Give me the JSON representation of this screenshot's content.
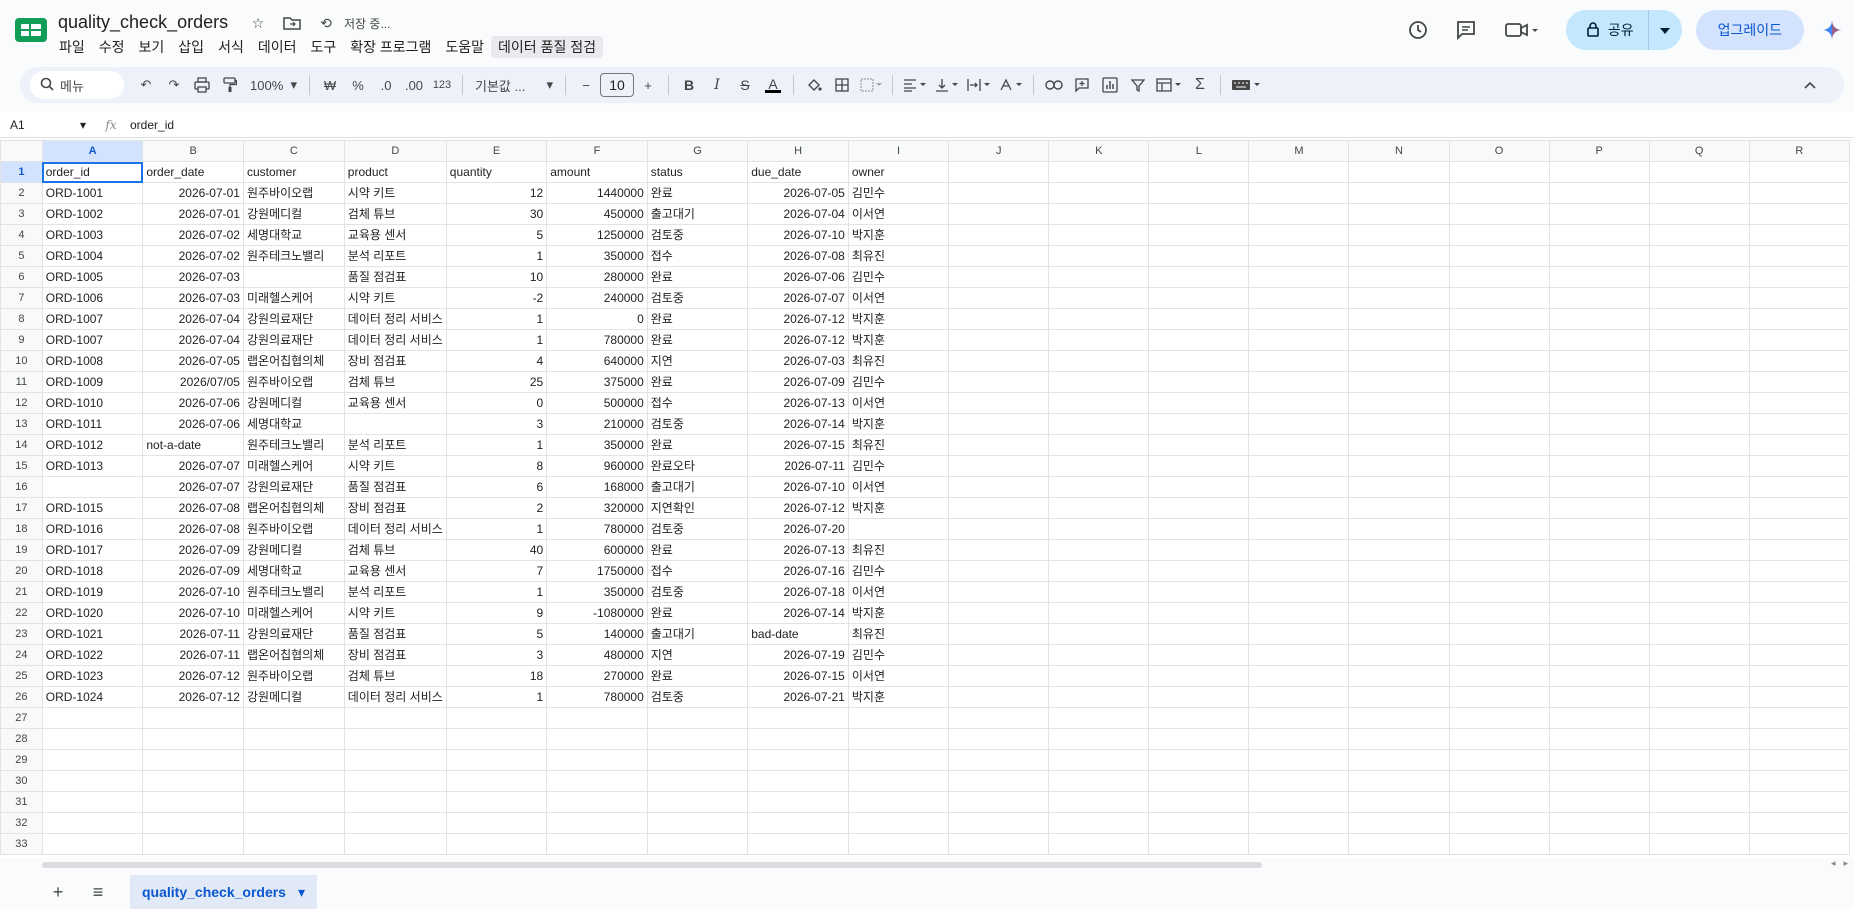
{
  "doc": {
    "title": "quality_check_orders",
    "saving": "저장 중..."
  },
  "menu": [
    "파일",
    "수정",
    "보기",
    "삽입",
    "서식",
    "데이터",
    "도구",
    "확장 프로그램",
    "도움말",
    "데이터 품질 점검"
  ],
  "actions": {
    "share": "공유",
    "upgrade": "업그레이드"
  },
  "toolbar": {
    "search": "메뉴",
    "zoom": "100%",
    "currency": "₩",
    "percent": "%",
    "dec_less": ".0",
    "dec_more": ".00",
    "format_123": "123",
    "font": "기본값 ...",
    "font_size": "10"
  },
  "formula_bar": {
    "cell": "A1",
    "content": "order_id"
  },
  "grid": {
    "columns": [
      "A",
      "B",
      "C",
      "D",
      "E",
      "F",
      "G",
      "H",
      "I",
      "J",
      "K",
      "L",
      "M",
      "N",
      "O",
      "P",
      "Q",
      "R"
    ],
    "row_count": 33,
    "rows": [
      [
        "order_id",
        "order_date",
        "customer",
        "product",
        "quantity",
        "amount",
        "status",
        "due_date",
        "owner"
      ],
      [
        "ORD-1001",
        "2026-07-01",
        "원주바이오랩",
        "시약 키트",
        "12",
        "1440000",
        "완료",
        "2026-07-05",
        "김민수"
      ],
      [
        "ORD-1002",
        "2026-07-01",
        "강원메디컬",
        "검체 튜브",
        "30",
        "450000",
        "출고대기",
        "2026-07-04",
        "이서연"
      ],
      [
        "ORD-1003",
        "2026-07-02",
        "세명대학교",
        "교육용 센서",
        "5",
        "1250000",
        "검토중",
        "2026-07-10",
        "박지훈"
      ],
      [
        "ORD-1004",
        "2026-07-02",
        "원주테크노밸리",
        "분석 리포트",
        "1",
        "350000",
        "접수",
        "2026-07-08",
        "최유진"
      ],
      [
        "ORD-1005",
        "2026-07-03",
        "",
        "품질 점검표",
        "10",
        "280000",
        "완료",
        "2026-07-06",
        "김민수"
      ],
      [
        "ORD-1006",
        "2026-07-03",
        "미래헬스케어",
        "시약 키트",
        "-2",
        "240000",
        "검토중",
        "2026-07-07",
        "이서연"
      ],
      [
        "ORD-1007",
        "2026-07-04",
        "강원의료재단",
        "데이터 정리 서비스",
        "1",
        "0",
        "완료",
        "2026-07-12",
        "박지훈"
      ],
      [
        "ORD-1007",
        "2026-07-04",
        "강원의료재단",
        "데이터 정리 서비스",
        "1",
        "780000",
        "완료",
        "2026-07-12",
        "박지훈"
      ],
      [
        "ORD-1008",
        "2026-07-05",
        "랩온어칩협의체",
        "장비 점검표",
        "4",
        "640000",
        "지연",
        "2026-07-03",
        "최유진"
      ],
      [
        "ORD-1009",
        "2026/07/05",
        "원주바이오랩",
        "검체 튜브",
        "25",
        "375000",
        "완료",
        "2026-07-09",
        "김민수"
      ],
      [
        "ORD-1010",
        "2026-07-06",
        "강원메디컬",
        "교육용 센서",
        "0",
        "500000",
        "접수",
        "2026-07-13",
        "이서연"
      ],
      [
        "ORD-1011",
        "2026-07-06",
        "세명대학교",
        "",
        "3",
        "210000",
        "검토중",
        "2026-07-14",
        "박지훈"
      ],
      [
        "ORD-1012",
        "not-a-date",
        "원주테크노밸리",
        "분석 리포트",
        "1",
        "350000",
        "완료",
        "2026-07-15",
        "최유진"
      ],
      [
        "ORD-1013",
        "2026-07-07",
        "미래헬스케어",
        "시약 키트",
        "8",
        "960000",
        "완료오타",
        "2026-07-11",
        "김민수"
      ],
      [
        "",
        "2026-07-07",
        "강원의료재단",
        "품질 점검표",
        "6",
        "168000",
        "출고대기",
        "2026-07-10",
        "이서연"
      ],
      [
        "ORD-1015",
        "2026-07-08",
        "랩온어칩협의체",
        "장비 점검표",
        "2",
        "320000",
        "지연확인",
        "2026-07-12",
        "박지훈"
      ],
      [
        "ORD-1016",
        "2026-07-08",
        "원주바이오랩",
        "데이터 정리 서비스",
        "1",
        "780000",
        "검토중",
        "2026-07-20",
        ""
      ],
      [
        "ORD-1017",
        "2026-07-09",
        "강원메디컬",
        "검체 튜브",
        "40",
        "600000",
        "완료",
        "2026-07-13",
        "최유진"
      ],
      [
        "ORD-1018",
        "2026-07-09",
        "세명대학교",
        "교육용 센서",
        "7",
        "1750000",
        "접수",
        "2026-07-16",
        "김민수"
      ],
      [
        "ORD-1019",
        "2026-07-10",
        "원주테크노밸리",
        "분석 리포트",
        "1",
        "350000",
        "검토중",
        "2026-07-18",
        "이서연"
      ],
      [
        "ORD-1020",
        "2026-07-10",
        "미래헬스케어",
        "시약 키트",
        "9",
        "-1080000",
        "완료",
        "2026-07-14",
        "박지훈"
      ],
      [
        "ORD-1021",
        "2026-07-11",
        "강원의료재단",
        "품질 점검표",
        "5",
        "140000",
        "출고대기",
        "bad-date",
        "최유진"
      ],
      [
        "ORD-1022",
        "2026-07-11",
        "랩온어칩협의체",
        "장비 점검표",
        "3",
        "480000",
        "지연",
        "2026-07-19",
        "김민수"
      ],
      [
        "ORD-1023",
        "2026-07-12",
        "원주바이오랩",
        "검체 튜브",
        "18",
        "270000",
        "완료",
        "2026-07-15",
        "이서연"
      ],
      [
        "ORD-1024",
        "2026-07-12",
        "강원메디컬",
        "데이터 정리 서비스",
        "1",
        "780000",
        "검토중",
        "2026-07-21",
        "박지훈"
      ]
    ]
  },
  "sheet_tab": "quality_check_orders",
  "colors": {
    "accent": "#0b57d0",
    "selection": "#1a73e8",
    "share_bg": "#c2e7ff"
  }
}
